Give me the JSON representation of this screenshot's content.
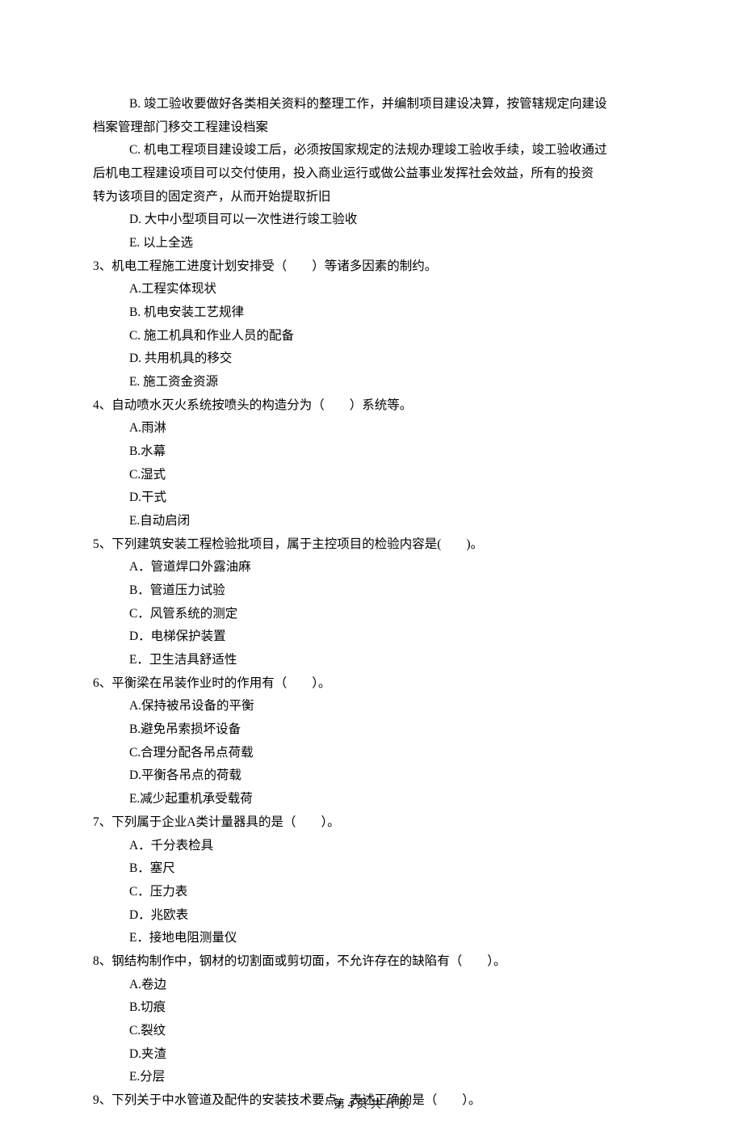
{
  "q2_continued": {
    "optB_line1": "B. 竣工验收要做好各类相关资料的整理工作，并编制项目建设决算，按管辖规定向建设",
    "optB_line2": "档案管理部门移交工程建设档案",
    "optC_line1": "C. 机电工程项目建设竣工后，必须按国家规定的法规办理竣工验收手续，竣工验收通过",
    "optC_line2": "后机电工程建设项目可以交付使用，投入商业运行或做公益事业发挥社会效益，所有的投资",
    "optC_line3": "转为该项目的固定资产，从而开始提取折旧",
    "optD": "D. 大中小型项目可以一次性进行竣工验收",
    "optE": "E. 以上全选"
  },
  "q3": {
    "stem": "3、机电工程施工进度计划安排受（　　）等诸多因素的制约。",
    "A": "A.工程实体现状",
    "B": "B. 机电安装工艺规律",
    "C": "C. 施工机具和作业人员的配备",
    "D": "D. 共用机具的移交",
    "E": "E. 施工资金资源"
  },
  "q4": {
    "stem": "4、自动喷水灭火系统按喷头的构造分为（　　）系统等。",
    "A": "A.雨淋",
    "B": "B.水幕",
    "C": "C.湿式",
    "D": "D.干式",
    "E": "E.自动启闭"
  },
  "q5": {
    "stem": "5、下列建筑安装工程检验批项目，属于主控项目的检验内容是(　　)。",
    "A": "A．管道焊口外露油麻",
    "B": "B．管道压力试验",
    "C": "C．风管系统的测定",
    "D": "D．电梯保护装置",
    "E": "E．卫生洁具舒适性"
  },
  "q6": {
    "stem": "6、平衡梁在吊装作业时的作用有（　　）。",
    "A": "A.保持被吊设备的平衡",
    "B": "B.避免吊索损坏设备",
    "C": "C.合理分配各吊点荷载",
    "D": "D.平衡各吊点的荷载",
    "E": "E.减少起重机承受载荷"
  },
  "q7": {
    "stem": "7、下列属于企业A类计量器具的是（　　）。",
    "A": "A．千分表检具",
    "B": "B．塞尺",
    "C": "C．压力表",
    "D": "D．兆欧表",
    "E": "E．接地电阻测量仪"
  },
  "q8": {
    "stem": "8、钢结构制作中，钢材的切割面或剪切面，不允许存在的缺陷有（　　）。",
    "A": "A.卷边",
    "B": "B.切痕",
    "C": "C.裂纹",
    "D": "D.夹渣",
    "E": "E.分层"
  },
  "q9": {
    "stem": "9、下列关于中水管道及配件的安装技术要点，表述正确的是（　　）。"
  },
  "footer": "第 4 页 共 11 页"
}
